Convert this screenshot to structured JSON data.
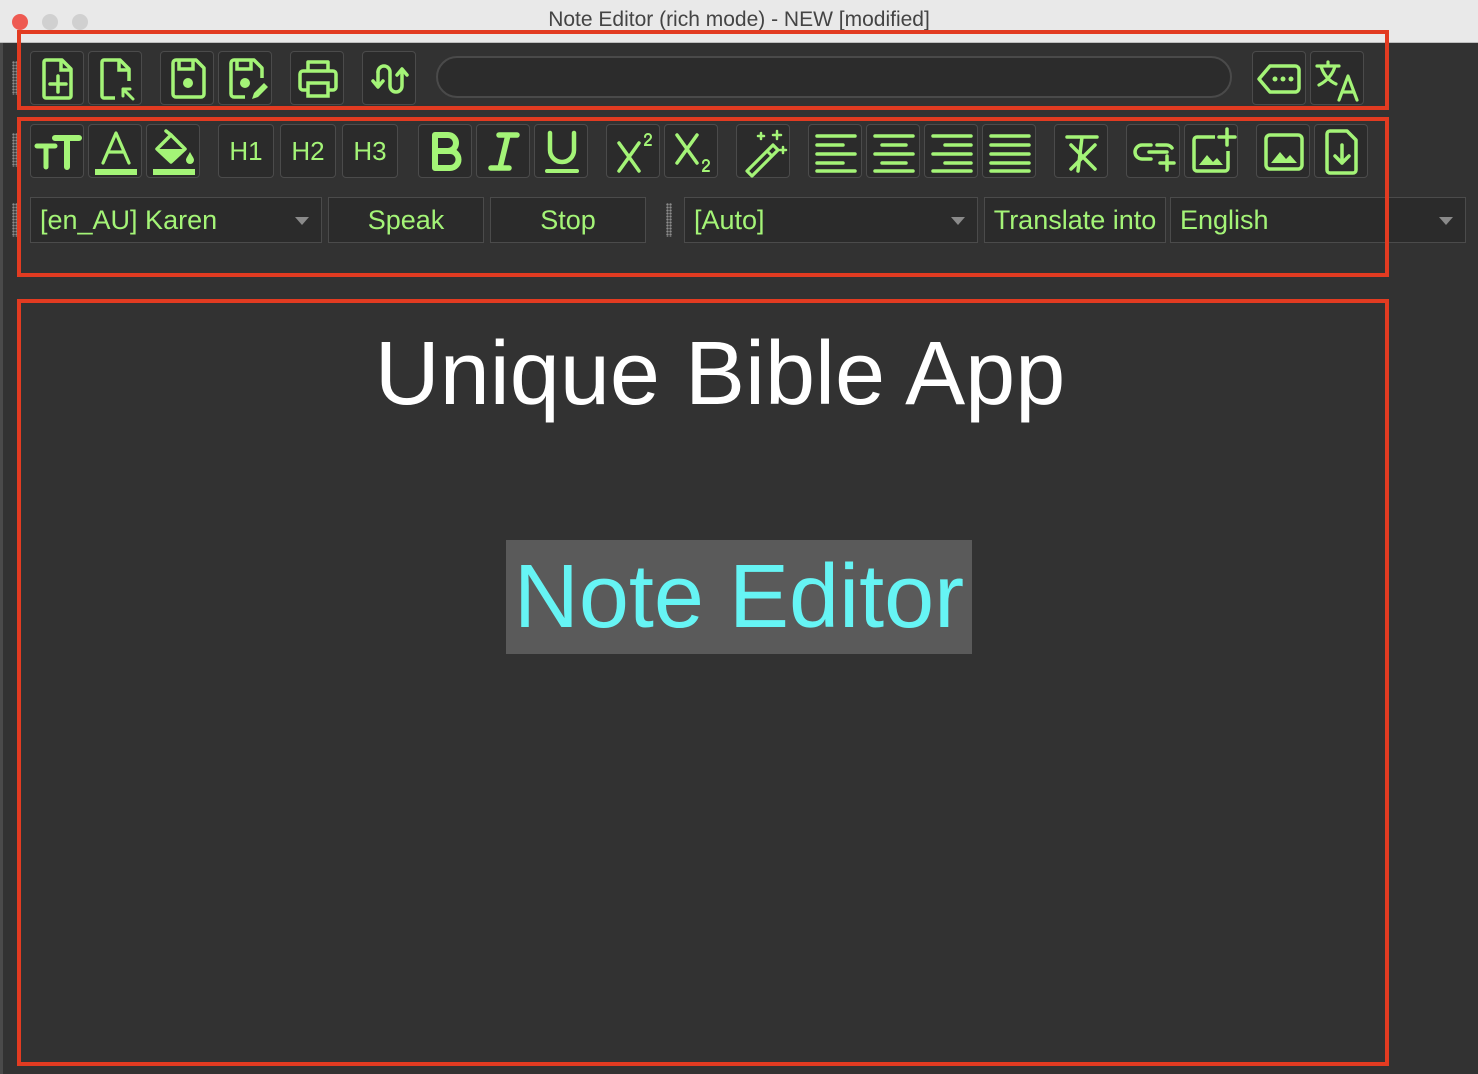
{
  "window": {
    "title": "Note Editor (rich mode) - NEW [modified]"
  },
  "toolbar1": {
    "buttons": [
      "new-file",
      "open-file",
      "save",
      "save-as",
      "print",
      "toggle-mode"
    ],
    "search_value": "",
    "right_buttons": [
      "more",
      "translate"
    ]
  },
  "toolbar2": {
    "heading_labels": [
      "H1",
      "H2",
      "H3"
    ]
  },
  "toolbar3": {
    "voice": "[en_AU] Karen",
    "speak_label": "Speak",
    "stop_label": "Stop",
    "source_language": "[Auto]",
    "translate_label": "Translate into",
    "target_language": "English"
  },
  "editor": {
    "heading": "Unique Bible App",
    "subheading": "Note Editor"
  },
  "colors": {
    "icon": "#a4f477",
    "highlight_box": "#e23b21",
    "subheading_text": "#66f4f4"
  }
}
